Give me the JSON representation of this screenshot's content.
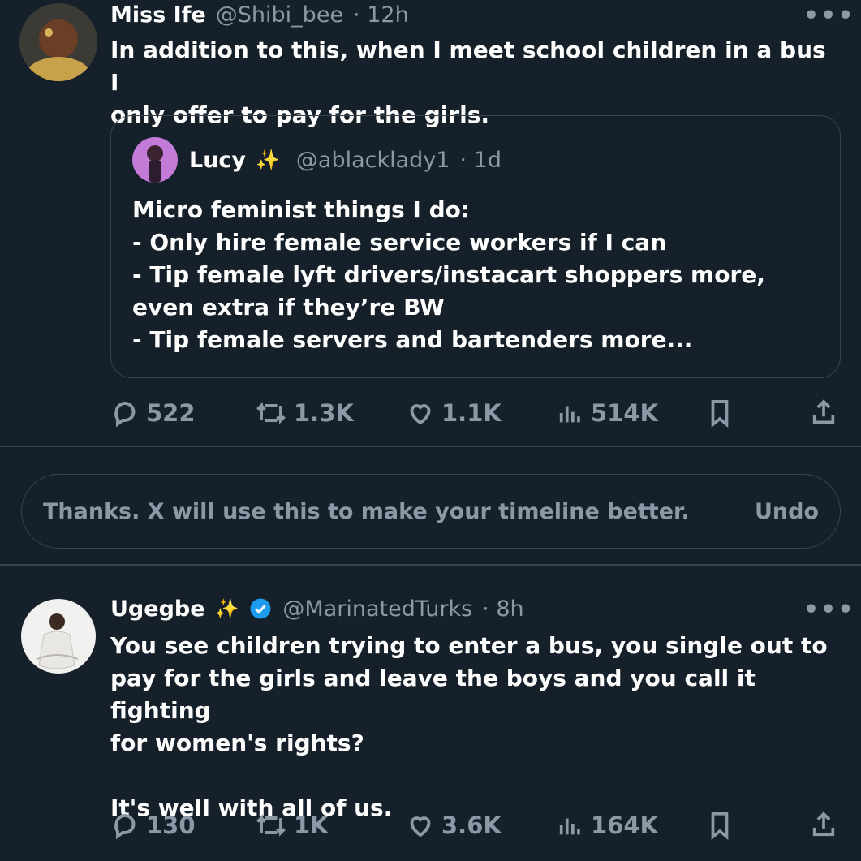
{
  "tweet1": {
    "name": "Miss Ife",
    "handle": "@Shibi_bee",
    "time": "· 12h",
    "text": "In addition to this, when I meet school children in a bus I\nonly offer to pay for the girls.",
    "quote": {
      "name": "Lucy",
      "sparkle": "✨",
      "handle": "@ablacklady1",
      "time": "· 1d",
      "text": "Micro feminist things I do:\n- Only hire female service workers if I can\n- Tip female lyft drivers/instacart shoppers more,\neven extra if they’re BW\n- Tip female servers and bartenders more..."
    },
    "stats": {
      "replies": "522",
      "retweets": "1.3K",
      "likes": "1.1K",
      "views": "514K"
    }
  },
  "toast": {
    "text": "Thanks. X will use this to make your timeline better.",
    "undo": "Undo"
  },
  "tweet2": {
    "name": "Ugegbe",
    "sparkle": "✨",
    "handle": "@MarinatedTurks",
    "time": "· 8h",
    "text": "You see children trying to enter a bus, you single out to\npay for the girls and leave the boys and you call it fighting\nfor women's rights?\n\nIt's well with all of us.",
    "stats": {
      "replies": "130",
      "retweets": "1K",
      "likes": "3.6K",
      "views": "164K"
    }
  },
  "colors": {
    "background": "#15202b",
    "muted": "#8b98a5",
    "border": "#38444d",
    "verified": "#1d9bf0"
  },
  "icons": [
    "reply-icon",
    "retweet-icon",
    "like-icon",
    "views-icon",
    "bookmark-icon",
    "share-icon",
    "more-icon",
    "verified-badge-icon"
  ]
}
